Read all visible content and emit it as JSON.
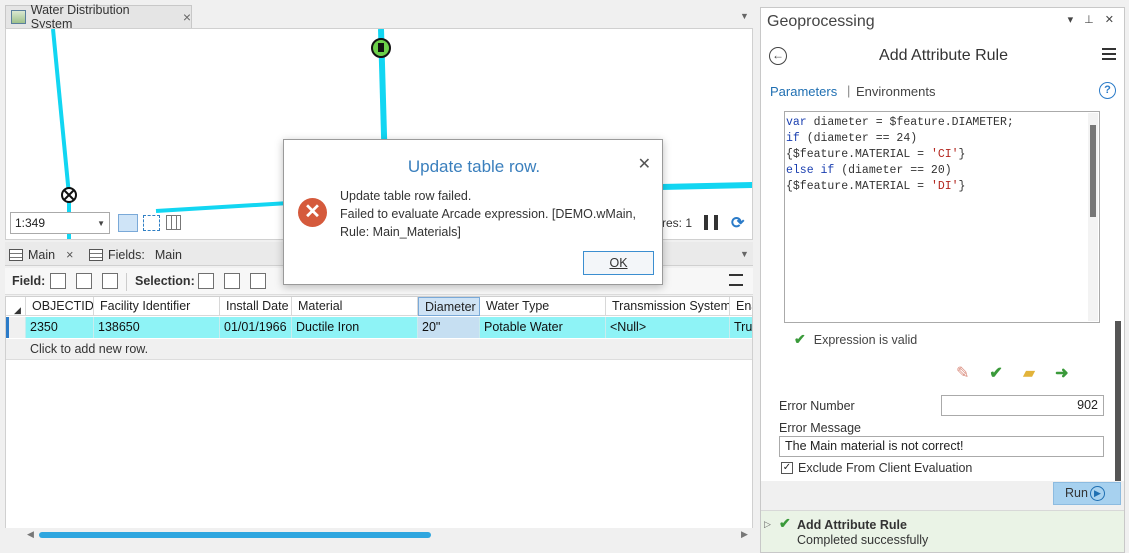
{
  "map": {
    "tab_label": "Water Distribution System",
    "scale": "1:349",
    "features_label": "res: 1"
  },
  "table": {
    "tabs": [
      {
        "label": "Main"
      },
      {
        "label": "Fields:",
        "sub": "Main"
      }
    ],
    "toolbar": {
      "field_label": "Field:",
      "selection_label": "Selection:"
    },
    "columns": [
      "OBJECTID",
      "Facility Identifier",
      "Install Date",
      "Material",
      "Diameter",
      "Water Type",
      "Transmission System",
      "Ena"
    ],
    "row": [
      "2350",
      "138650",
      "01/01/1966",
      "Ductile Iron",
      "20\"",
      "Potable Water",
      "<Null>",
      "True"
    ],
    "add_row_text": "Click to add new row."
  },
  "dialog": {
    "title": "Update table row.",
    "message": "Update table row failed.\nFailed to evaluate Arcade expression. [DEMO.wMain, Rule: Main_Materials]",
    "ok": "OK"
  },
  "gp": {
    "pane_title": "Geoprocessing",
    "tool_title": "Add Attribute Rule",
    "tab_params": "Parameters",
    "tab_env": "Environments",
    "code_lines": [
      "var diameter = $feature.DIAMETER;",
      "if (diameter == 24)",
      "{$feature.MATERIAL = 'CI'}",
      "else if (diameter == 20)",
      "{$feature.MATERIAL = 'DI'}"
    ],
    "valid_text": "Expression is valid",
    "error_number_label": "Error Number",
    "error_number": "902",
    "error_message_label": "Error Message",
    "error_message": "The Main material is not correct!",
    "exclude_label": "Exclude From Client Evaluation",
    "run_label": "Run",
    "history_title": "Add Attribute Rule",
    "history_status": "Completed successfully"
  },
  "colors": {
    "pipe": "#12d6f2",
    "selected_row": "#8ef3f6",
    "accent": "#1f6fb2",
    "error": "#d55a3c"
  }
}
